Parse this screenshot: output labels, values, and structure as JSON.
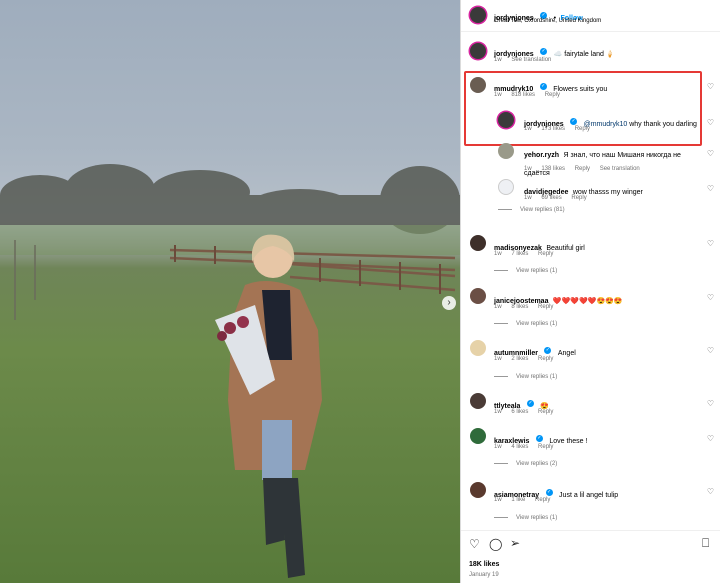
{
  "post": {
    "username": "jordynjones",
    "follow_label": "Follow",
    "location": "Great Tew, Oxfordshire, United Kingdom",
    "caption_user": "jordynjones",
    "caption": "☁️ fairytale land 🍦",
    "caption_time": "1w",
    "see_translation": "See translation"
  },
  "comments": [
    {
      "user": "mmudryk10",
      "text": "Flowers suits you",
      "time": "1w",
      "likes": "818 likes",
      "reply": "Reply"
    },
    {
      "user": "jordynjones",
      "mention": "@mmudryk10",
      "text": " why thank you darling",
      "time": "1w",
      "likes": "173 likes",
      "reply": "Reply"
    },
    {
      "user": "yehor.ryzh",
      "text": "Я знал, что наш Мишаня никогда не сдаётся",
      "time": "1w",
      "likes": "138 likes",
      "reply": "Reply",
      "extra": "See translation"
    },
    {
      "user": "davidjegedee",
      "text": "wow thasss my winger",
      "time": "1w",
      "likes": "69 likes",
      "reply": "Reply",
      "view_replies": "View replies (81)"
    },
    {
      "user": "madisonyezak",
      "text": "Beautiful girl",
      "time": "1w",
      "likes": "7 likes",
      "reply": "Reply",
      "view_replies": "View replies (1)"
    },
    {
      "user": "janicejoostemaa",
      "text": "❤️❤️❤️❤️❤️😍😍😍",
      "time": "1w",
      "likes": "8 likes",
      "reply": "Reply",
      "view_replies": "View replies (1)"
    },
    {
      "user": "autumnmiller",
      "text": "Angel",
      "time": "1w",
      "likes": "2 likes",
      "reply": "Reply",
      "view_replies": "View replies (1)"
    },
    {
      "user": "ttlyteala",
      "text": "😍",
      "time": "1w",
      "likes": "6 likes",
      "reply": "Reply"
    },
    {
      "user": "karaxlewis",
      "text": "Love these !",
      "time": "1w",
      "likes": "4 likes",
      "reply": "Reply",
      "view_replies": "View replies (2)"
    },
    {
      "user": "asiamonetray",
      "text": "Just a lil angel tulip",
      "time": "1w",
      "likes": "1 like",
      "reply": "Reply",
      "view_replies": "View replies (1)"
    }
  ],
  "footer": {
    "likes": "18K likes",
    "date": "January 19"
  },
  "icons": {
    "heart": "heart-icon",
    "comment": "comment-icon",
    "share": "share-icon",
    "save": "bookmark-icon",
    "next": "chevron-right-icon"
  },
  "colors": {
    "accent": "#0095f6",
    "highlight": "#e53935"
  }
}
